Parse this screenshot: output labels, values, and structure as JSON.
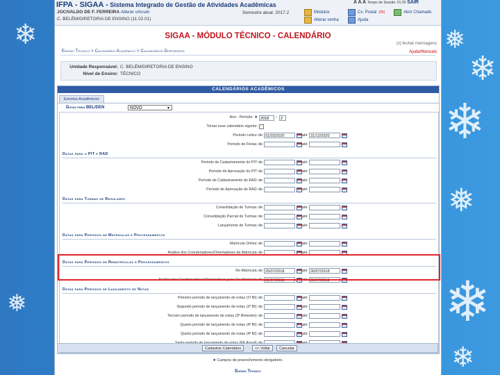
{
  "header": {
    "system_short": "IFPA - SIGAA -",
    "system_full": "Sistema Integrado de Gestão de Atividades Acadêmicas",
    "user_line": "JOCIVALDO DE F. FERREIRA",
    "user_link": "Alterar vínculo",
    "unit_line": "C. BELÉM/DIRETORIA DE ENSINO (11.02.01)",
    "semester": "Semestre atual: 2017.2",
    "font_ctrl": "A A A",
    "timer": "Tempo de Sessão: 01:29",
    "logout": "SAIR",
    "buttons": [
      {
        "label": "Módulos"
      },
      {
        "label": "Cx. Postal",
        "badge": "(25)"
      },
      {
        "label": "Abrir Chamado"
      },
      {
        "label": "Alterar senha"
      },
      {
        "label": "Ajuda"
      }
    ]
  },
  "page": {
    "title": "SIGAA - MÓDULO TÉCNICO - CALENDÁRIO",
    "close_messages": "(x) fechar mensagens",
    "help_manuals": "Ajuda/Manuais",
    "breadcrumb": "Ensino Técnico > Calendário Acadêmico > Calendários Disponíveis"
  },
  "info": {
    "unit_label": "Unidade Responsável:",
    "unit_value": "C. BELÉM/DIRETORIA DE ENSINO",
    "level_label": "Nível de Ensino:",
    "level_value": "TÉCNICO"
  },
  "panel": {
    "header": "CALENDÁRIOS ACADÊMICOS",
    "tab": "Eventos Acadêmicos",
    "datas_label": "Datas para BEL/DEN",
    "select_value": "NOVO",
    "ano_label": "Ano - Período:",
    "ano_value": "2018",
    "periodo_value": "2",
    "tornar_label": "Tornar esse calendário vigente:",
    "rows_top": [
      {
        "label": "Período Letivo:",
        "de_val": "01/03/2020",
        "ate_val": "31/12/2020"
      },
      {
        "label": "Período de Férias:",
        "de_val": "",
        "ate_val": ""
      }
    ],
    "sections": [
      {
        "title": "Datas para o PIT e RAD",
        "rows": [
          {
            "label": "Período de Cadastramento do PIT:"
          },
          {
            "label": "Período de Aprovação do PIT:"
          },
          {
            "label": "Período de Cadastramento do RAD:"
          },
          {
            "label": "Período de Aprovação do RAD:"
          }
        ]
      },
      {
        "title": "Datas para Turmas de Regulares",
        "rows": [
          {
            "label": "Consolidação de Turmas:"
          },
          {
            "label": "Consolidação Parcial de Turmas:"
          },
          {
            "label": "Lançamento de Turmas:"
          }
        ]
      },
      {
        "title": "Datas para Períodos de Matrículas e Processamentos",
        "rows": [
          {
            "label": "Matrícula Online:"
          },
          {
            "label": "Análise dos Coordenadores/Orientadores da Matrícula:"
          }
        ]
      },
      {
        "title": "Datas para Períodos de Rematrículas e Processamentos",
        "rows": [
          {
            "label": "Re-Matrícula:",
            "de_val": "25/07/2018",
            "ate_val": "30/07/2018"
          },
          {
            "label": "Análise dos Coordenadores/Orientadores para Re-Matrícula:",
            "de_val": "25/07/2018",
            "ate_val": "30/07/2018"
          }
        ]
      },
      {
        "title": "Datas para Períodos de Lançamento de Notas",
        "rows": [
          {
            "label": "Primeiro período de lançamento de notas (1ª BI):"
          },
          {
            "label": "Segundo período de lançamento de notas (2ª BI):"
          },
          {
            "label": "Terceiro período de lançamento de notas (3ª Bimestre):"
          },
          {
            "label": "Quarto período de lançamento de notas (4ª BI):"
          },
          {
            "label": "Quinto período de lançamento de notas (4ª BI):"
          },
          {
            "label": "Sexto período de lançamento de notas (PF Anual):"
          }
        ]
      }
    ],
    "de": "de",
    "ate": "até",
    "buttons": {
      "save": "Cadastrar Calendário",
      "back": "<< Voltar",
      "cancel": "Cancelar"
    },
    "required_note": "Campos de preenchimento obrigatório.",
    "footer": "Ensino Técnico"
  },
  "colors": {
    "title_red": "#c0151d",
    "panel_blue": "#2f5ba4",
    "highlight": "#e0232c",
    "background": "#2b8ad6"
  }
}
